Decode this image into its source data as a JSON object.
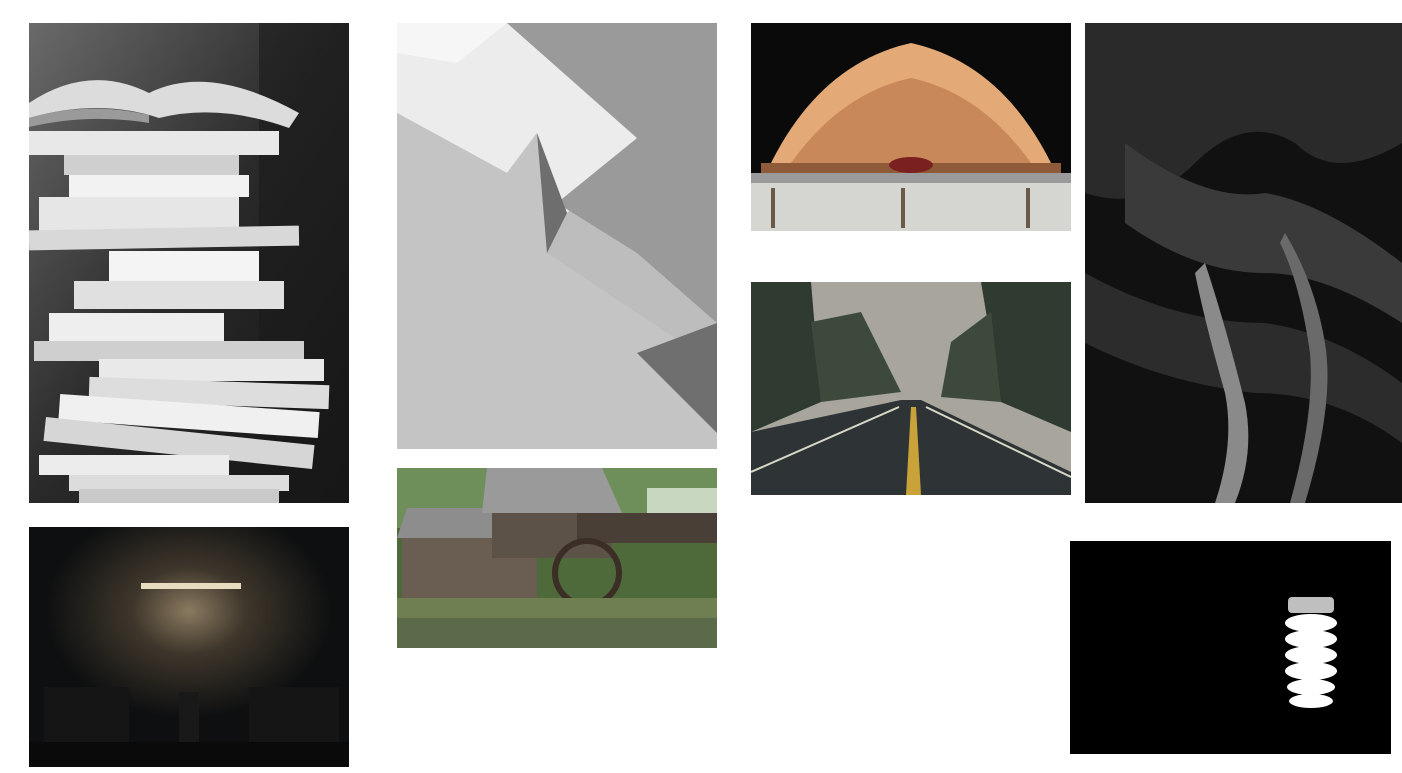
{
  "gallery": {
    "tiles": [
      {
        "subject": "stack-of-books",
        "tone": "black-and-white"
      },
      {
        "subject": "night-wall-lamp-benches",
        "tone": "dark"
      },
      {
        "subject": "abstract-paper-folds",
        "tone": "grayscale"
      },
      {
        "subject": "watermill-cabin",
        "tone": "color"
      },
      {
        "subject": "open-book-fanned-pages",
        "tone": "warm"
      },
      {
        "subject": "wet-forest-road",
        "tone": "muted"
      },
      {
        "subject": "dark-rock-texture",
        "tone": "black-and-white"
      },
      {
        "subject": "spiral-light-bulb",
        "tone": "black"
      }
    ]
  }
}
